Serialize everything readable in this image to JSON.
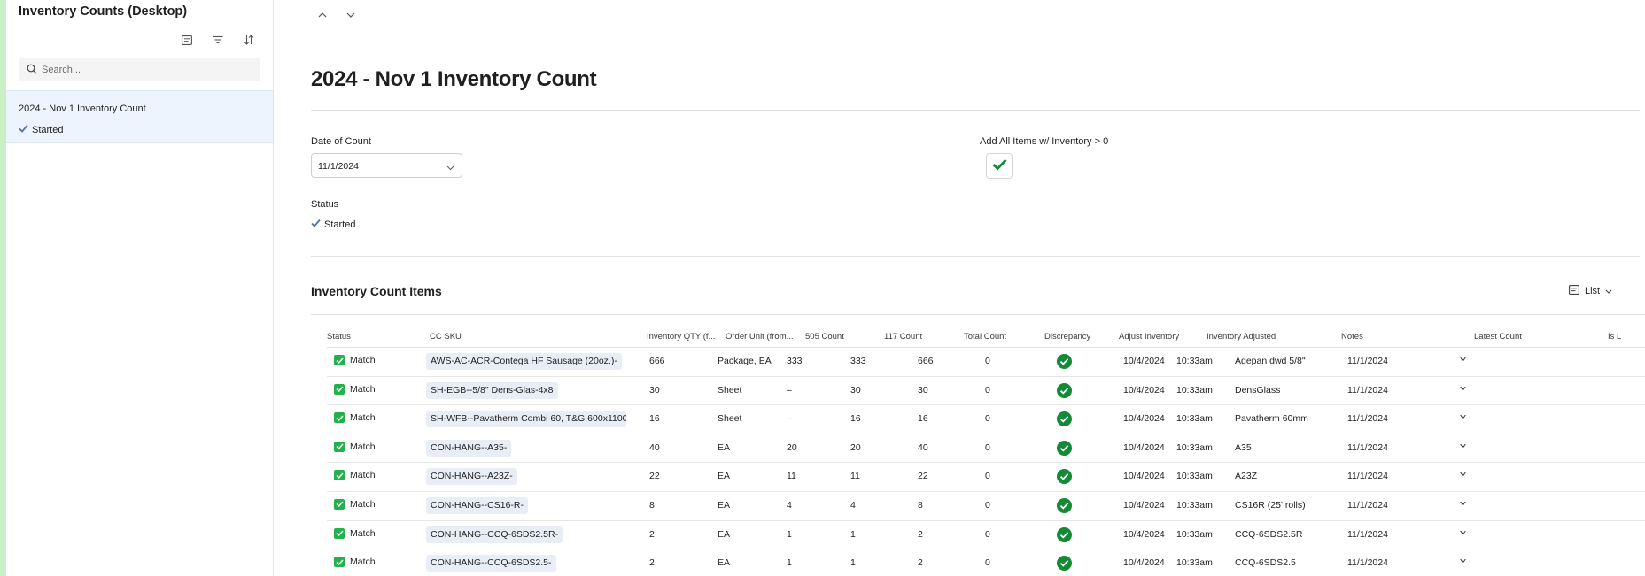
{
  "sidebar": {
    "title": "Inventory Counts (Desktop)",
    "search_placeholder": "Search...",
    "items": [
      {
        "title": "2024 - Nov 1 Inventory Count",
        "status": "Started"
      }
    ]
  },
  "main": {
    "title": "2024 - Nov 1 Inventory Count",
    "fields": {
      "date_label": "Date of Count",
      "date_value": "11/1/2024",
      "add_all_label": "Add All Items w/ Inventory > 0",
      "status_label": "Status",
      "status_value": "Started"
    },
    "section_title": "Inventory Count Items",
    "view_label": "List"
  },
  "colors": {
    "accent_strip": "#c9efc4",
    "check_green": "#22b14c",
    "adjust_green": "#138a36",
    "sidebar_selected": "#eef4fd",
    "status_check": "#5a6ea8"
  },
  "table": {
    "headers": [
      "Status",
      "CC SKU",
      "Inventory QTY (f...",
      "Order Unit (from...",
      "505 Count",
      "117 Count",
      "Total Count",
      "Discrepancy",
      "Adjust Inventory",
      "Inventory Adjusted",
      "Notes",
      "Latest Count",
      "Is L"
    ],
    "rows": [
      {
        "status": "Match",
        "sku": "AWS-AC-ACR-Contega HF Sausage (20oz.)-",
        "qty": "666",
        "unit": "Package, EA",
        "c505": "333",
        "c117": "333",
        "total": "666",
        "disc": "0",
        "adj_date": "10/4/2024",
        "adj_time": "10:33am",
        "notes": "Agepan dwd 5/8\"",
        "latest": "11/1/2024",
        "is": "Y"
      },
      {
        "status": "Match",
        "sku": "SH-EGB--5/8\" Dens-Glas-4x8",
        "qty": "30",
        "unit": "Sheet",
        "c505": "–",
        "c117": "30",
        "total": "30",
        "disc": "0",
        "adj_date": "10/4/2024",
        "adj_time": "10:33am",
        "notes": "DensGlass",
        "latest": "11/1/2024",
        "is": "Y"
      },
      {
        "status": "Match",
        "sku": "SH-WFB--Pavatherm Combi 60, T&G 600x1100",
        "qty": "16",
        "unit": "Sheet",
        "c505": "–",
        "c117": "16",
        "total": "16",
        "disc": "0",
        "adj_date": "10/4/2024",
        "adj_time": "10:33am",
        "notes": "Pavatherm 60mm",
        "latest": "11/1/2024",
        "is": "Y"
      },
      {
        "status": "Match",
        "sku": "CON-HANG--A35-",
        "qty": "40",
        "unit": "EA",
        "c505": "20",
        "c117": "20",
        "total": "40",
        "disc": "0",
        "adj_date": "10/4/2024",
        "adj_time": "10:33am",
        "notes": "A35",
        "latest": "11/1/2024",
        "is": "Y"
      },
      {
        "status": "Match",
        "sku": "CON-HANG--A23Z-",
        "qty": "22",
        "unit": "EA",
        "c505": "11",
        "c117": "11",
        "total": "22",
        "disc": "0",
        "adj_date": "10/4/2024",
        "adj_time": "10:33am",
        "notes": "A23Z",
        "latest": "11/1/2024",
        "is": "Y"
      },
      {
        "status": "Match",
        "sku": "CON-HANG--CS16-R-",
        "qty": "8",
        "unit": "EA",
        "c505": "4",
        "c117": "4",
        "total": "8",
        "disc": "0",
        "adj_date": "10/4/2024",
        "adj_time": "10:33am",
        "notes": "CS16R (25' rolls)",
        "latest": "11/1/2024",
        "is": "Y"
      },
      {
        "status": "Match",
        "sku": "CON-HANG--CCQ-6SDS2.5R-",
        "qty": "2",
        "unit": "EA",
        "c505": "1",
        "c117": "1",
        "total": "2",
        "disc": "0",
        "adj_date": "10/4/2024",
        "adj_time": "10:33am",
        "notes": "CCQ-6SDS2.5R",
        "latest": "11/1/2024",
        "is": "Y"
      },
      {
        "status": "Match",
        "sku": "CON-HANG--CCQ-6SDS2.5-",
        "qty": "2",
        "unit": "EA",
        "c505": "1",
        "c117": "1",
        "total": "2",
        "disc": "0",
        "adj_date": "10/4/2024",
        "adj_time": "10:33am",
        "notes": "CCQ-6SDS2.5",
        "latest": "11/1/2024",
        "is": "Y"
      }
    ]
  }
}
